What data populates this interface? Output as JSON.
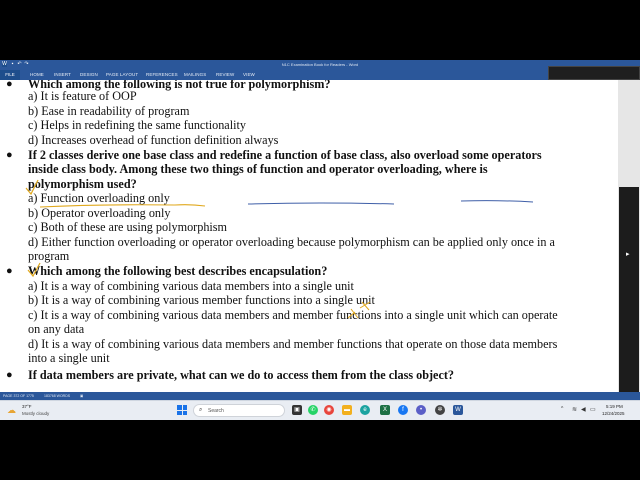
{
  "window": {
    "title": "N1C Examination Book for Readers - Word"
  },
  "ribbon": {
    "tabs": [
      "FILE",
      "HOME",
      "INSERT",
      "DESIGN",
      "PAGE LAYOUT",
      "REFERENCES",
      "MAILINGS",
      "REVIEW",
      "VIEW"
    ]
  },
  "document": {
    "lines": [
      {
        "kind": "question",
        "text": "Which among the following is not true for polymorphism?"
      },
      {
        "kind": "option",
        "text": "a) It is feature of OOP"
      },
      {
        "kind": "option",
        "text": "b) Ease in readability of program"
      },
      {
        "kind": "option",
        "text": "c) Helps in redefining the same functionality"
      },
      {
        "kind": "option",
        "text": "d) Increases overhead of function definition always"
      },
      {
        "kind": "question",
        "text": "If 2 classes derive one base class and redefine a function of base class, also overload some operators"
      },
      {
        "kind": "question-cont",
        "text": "inside class body. Among these two things of function and operator overloading, where is"
      },
      {
        "kind": "question-cont",
        "text": "polymorphism used?"
      },
      {
        "kind": "option",
        "text": "a) Function overloading only"
      },
      {
        "kind": "option",
        "text": "b) Operator overloading only"
      },
      {
        "kind": "option",
        "text": "c) Both of these are using polymorphism"
      },
      {
        "kind": "option",
        "text": "d) Either function overloading or operator overloading because polymorphism can be applied only once in a"
      },
      {
        "kind": "option-cont",
        "text": "program"
      },
      {
        "kind": "question",
        "text": "Which among the following best describes encapsulation?"
      },
      {
        "kind": "option",
        "text": "a) It is a way of combining various data members into a single unit"
      },
      {
        "kind": "option",
        "text": "b) It is a way of combining various member functions into a single unit"
      },
      {
        "kind": "option",
        "text": "c) It is a way of combining various data members and member functions into a single unit which can operate"
      },
      {
        "kind": "option-cont",
        "text": "on any data"
      },
      {
        "kind": "option",
        "text": "d) It is a way of combining various data members and member functions that operate on those data members"
      },
      {
        "kind": "option-cont",
        "text": "into a single unit"
      },
      {
        "kind": "question",
        "text": "If data members are private, what can we do to access them from the class object?"
      }
    ]
  },
  "statusbar": {
    "page": "PAGE 372 OF 1775",
    "words": "183768 WORDS"
  },
  "taskbar": {
    "weather_temp": "37°F",
    "weather_desc": "Mostly cloudy",
    "search_placeholder": "Search",
    "time": "5:19 PM",
    "date": "12/24/2025"
  },
  "colors": {
    "ribbon": "#2b579a",
    "taskbar": "#e9edf3",
    "annotation": "#e0a81c",
    "annotation_blue": "#3f5fa8"
  },
  "icons": [
    "word-logo-icon",
    "save-icon",
    "undo-icon",
    "redo-icon",
    "minimize-icon",
    "restore-icon",
    "close-icon",
    "weather-icon",
    "windows-start-icon",
    "search-icon",
    "task-view-icon",
    "whatsapp-icon",
    "chrome-icon",
    "file-explorer-icon",
    "edge-icon",
    "excel-icon",
    "facebook-icon",
    "teams-icon",
    "settings-icon",
    "word-app-icon",
    "wifi-icon",
    "volume-icon",
    "battery-icon"
  ]
}
